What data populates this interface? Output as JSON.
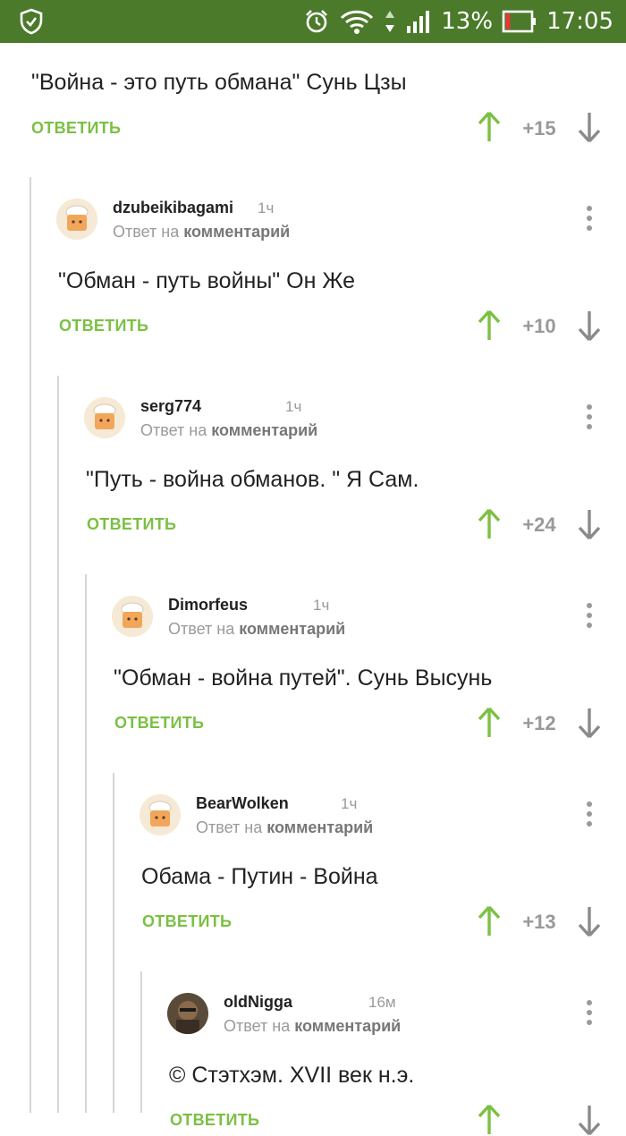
{
  "status_bar": {
    "battery": "13%",
    "time": "17:05",
    "icons": [
      "shield-check-icon",
      "alarm-icon",
      "wifi-icon",
      "signal-icon",
      "battery-icon"
    ],
    "background": "#4a7a2a"
  },
  "colors": {
    "accent_green": "#7bc043",
    "up_arrow": "#7bc043",
    "down_arrow": "#8a8a8a",
    "muted": "#9a9a9a"
  },
  "top_comment": {
    "text": "\"Война - это путь обмана\" Сунь Цзы",
    "reply_label": "ОТВЕТИТЬ",
    "score": "+15"
  },
  "comments": [
    {
      "username": "dzubeikibagami",
      "time": "1ч",
      "reply_prefix": "Ответ на",
      "reply_target": "комментарий",
      "text": "\"Обман - путь войны\" Он Же",
      "reply_label": "ОТВЕТИТЬ",
      "score": "+10",
      "avatar": "chef-hat-avatar"
    },
    {
      "username": "serg774",
      "time": "1ч",
      "reply_prefix": "Ответ на",
      "reply_target": "комментарий",
      "text": "\"Путь - война обманов. \" Я Сам.",
      "reply_label": "ОТВЕТИТЬ",
      "score": "+24",
      "avatar": "chef-hat-avatar"
    },
    {
      "username": "Dimorfeus",
      "time": "1ч",
      "reply_prefix": "Ответ на",
      "reply_target": "комментарий",
      "text": "\"Обман - война путей\". Сунь Высунь",
      "reply_label": "ОТВЕТИТЬ",
      "score": "+12",
      "avatar": "chef-hat-avatar"
    },
    {
      "username": "BearWolken",
      "time": "1ч",
      "reply_prefix": "Ответ на",
      "reply_target": "комментарий",
      "text": "Обама - Путин - Война",
      "reply_label": "ОТВЕТИТЬ",
      "score": "+13",
      "avatar": "chef-hat-avatar"
    },
    {
      "username": "oldNigga",
      "time": "16м",
      "reply_prefix": "Ответ на",
      "reply_target": "комментарий",
      "text": "© Стэтхэм. XVII век н.э.",
      "reply_label": "ОТВЕТИТЬ",
      "score": "",
      "avatar": "photo-avatar"
    }
  ]
}
